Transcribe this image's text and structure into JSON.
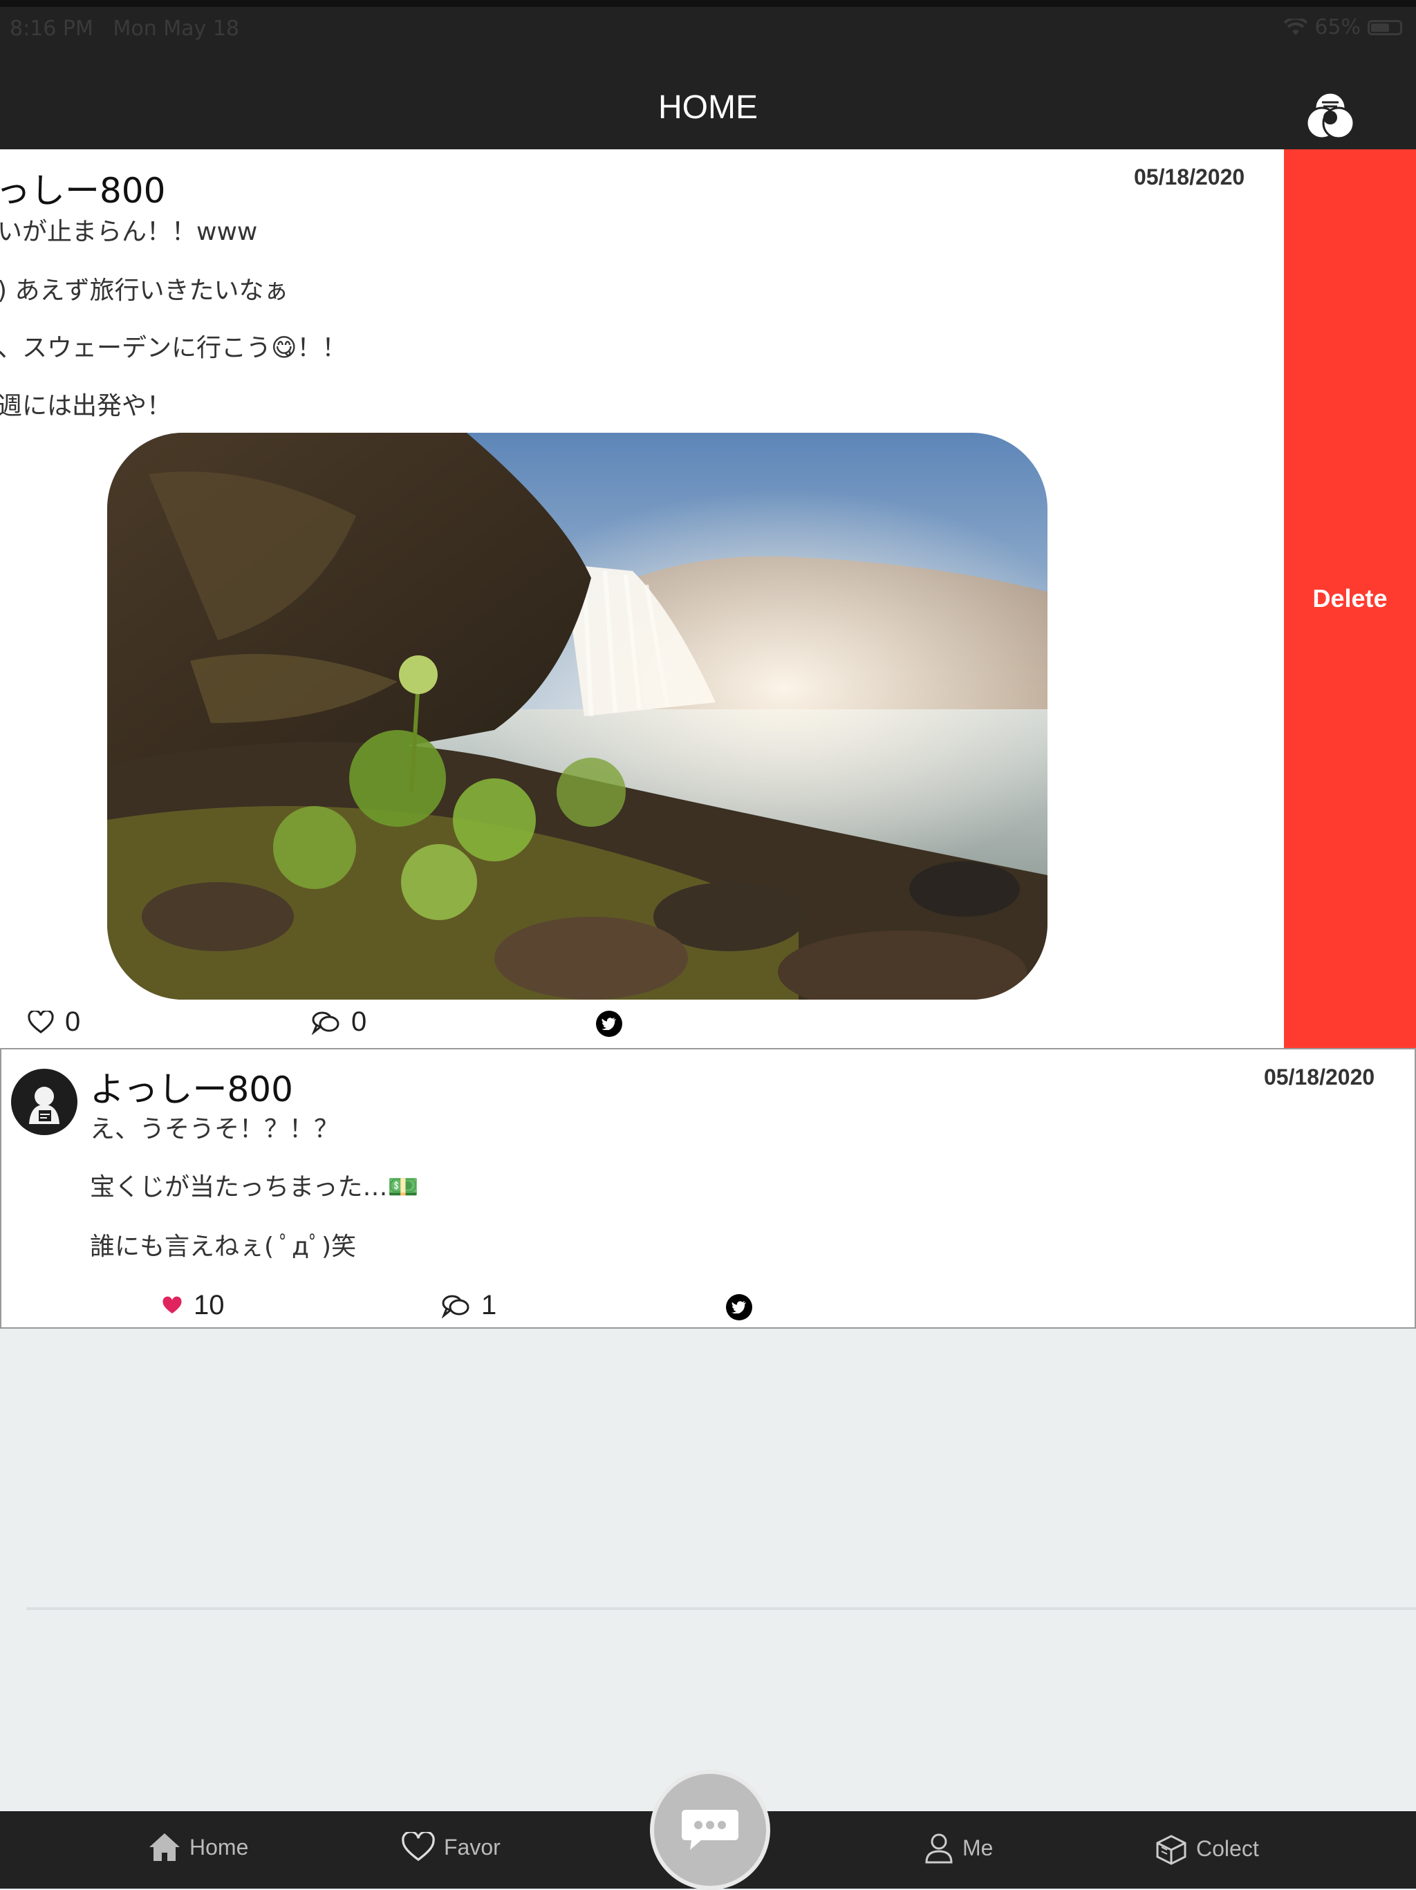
{
  "status": {
    "time": "8:16 PM",
    "date": "Mon May 18",
    "battery": "65%",
    "battery_level": 0.65
  },
  "header": {
    "title": "HOME"
  },
  "posts": [
    {
      "username": "っしー800",
      "date": "05/18/2020",
      "lines": [
        "いが止まらん！！www",
        ") あえず旅行いきたいなぁ",
        "、スウェーデンに行こう😋！！",
        "週には出発や！"
      ],
      "likes": "0",
      "comments": "0",
      "delete_label": "Delete"
    },
    {
      "username": "よっしー800",
      "date": "05/18/2020",
      "lines": [
        "え、うそうそ！？！？",
        "宝くじが当たっちまった…💵",
        "誰にも言えねぇ( ﾟдﾟ)笑"
      ],
      "likes": "10",
      "comments": "1"
    }
  ],
  "tabs": {
    "home": "Home",
    "favor": "Favor",
    "me": "Me",
    "collect": "Colect"
  },
  "colors": {
    "delete": "#FF3B30",
    "like_active": "#E0245E",
    "bar": "#222222"
  }
}
